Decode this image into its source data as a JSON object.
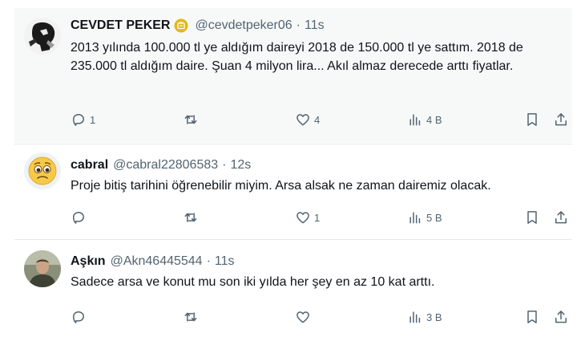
{
  "tweets": [
    {
      "name": "CEVDET PEKER",
      "handle": "@cevdetpeker06",
      "time": "11s",
      "text": "2013 yılında 100.000 tl ye aldığım daireyi 2018 de 150.000 tl ye sattım. 2018 de 235.000 tl aldığım daire. Şuan 4 milyon lira... Akıl almaz derecede arttı fiyatlar.",
      "replies": "1",
      "retweets": "",
      "likes": "4",
      "views": "4 B",
      "verified_badge": "gold",
      "badge_color": "#e2b719"
    },
    {
      "name": "cabral",
      "handle": "@cabral22806583",
      "time": "12s",
      "text": "Proje bitiş tarihini öğrenebilir miyim. Arsa alsak ne zaman dairemiz olacak.",
      "replies": "",
      "retweets": "",
      "likes": "1",
      "views": "5 B",
      "avatar_icon": "worried-face-emoji"
    },
    {
      "name": "Aşkın",
      "handle": "@Akn46445544",
      "time": "11s",
      "text": "Sadece arsa ve konut mu son iki yılda her şey en az 10 kat arttı.",
      "replies": "",
      "retweets": "",
      "likes": "",
      "views": "3 B"
    }
  ],
  "separator": "·",
  "colors": {
    "muted": "#536471",
    "text": "#0f1419",
    "highlight_bg": "#f7f9f9"
  }
}
